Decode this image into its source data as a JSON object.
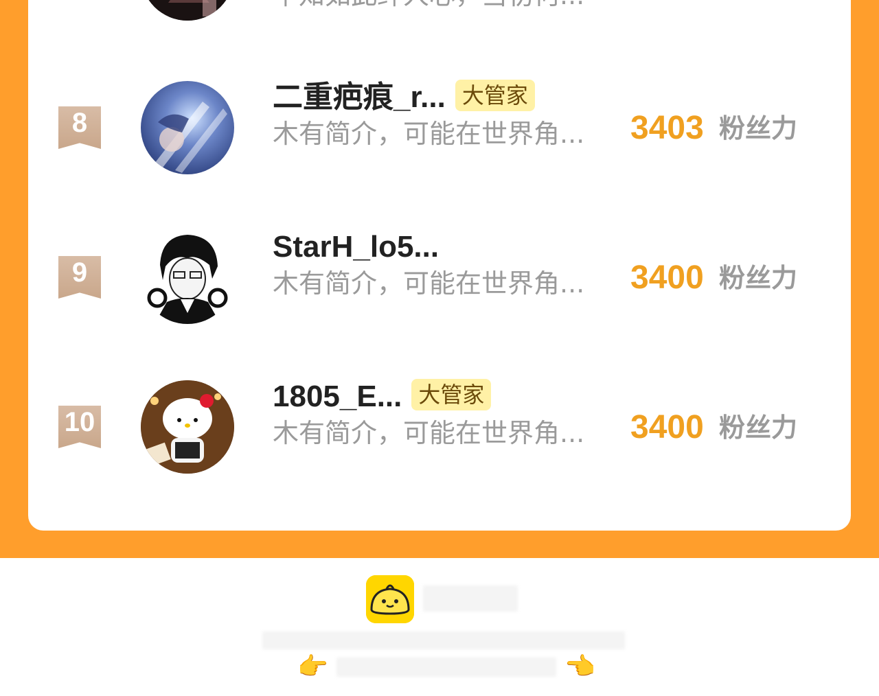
{
  "ranking": {
    "prev_row_bio": "早知如此绊人心，当初何...",
    "rows": [
      {
        "rank": "8",
        "name": "二重疤痕_r...",
        "badge": "大管家",
        "bio": "木有简介，可能在世界角...",
        "score": "3403",
        "unit": "粉丝力"
      },
      {
        "rank": "9",
        "name": "StarH_lo5...",
        "badge": "",
        "bio": "木有简介，可能在世界角...",
        "score": "3400",
        "unit": "粉丝力"
      },
      {
        "rank": "10",
        "name": "1805_E...",
        "badge": "大管家",
        "bio": "木有简介，可能在世界角...",
        "score": "3400",
        "unit": "粉丝力"
      }
    ]
  },
  "footer": {
    "left_hand": "👉",
    "right_hand": "👈",
    "logo_icon": "bun-mascot-icon"
  },
  "colors": {
    "frame": "#FF9E2C",
    "score": "#F0A020",
    "badge_bg": "#FFF1A6",
    "rank_ribbon": "#D4B49C"
  }
}
